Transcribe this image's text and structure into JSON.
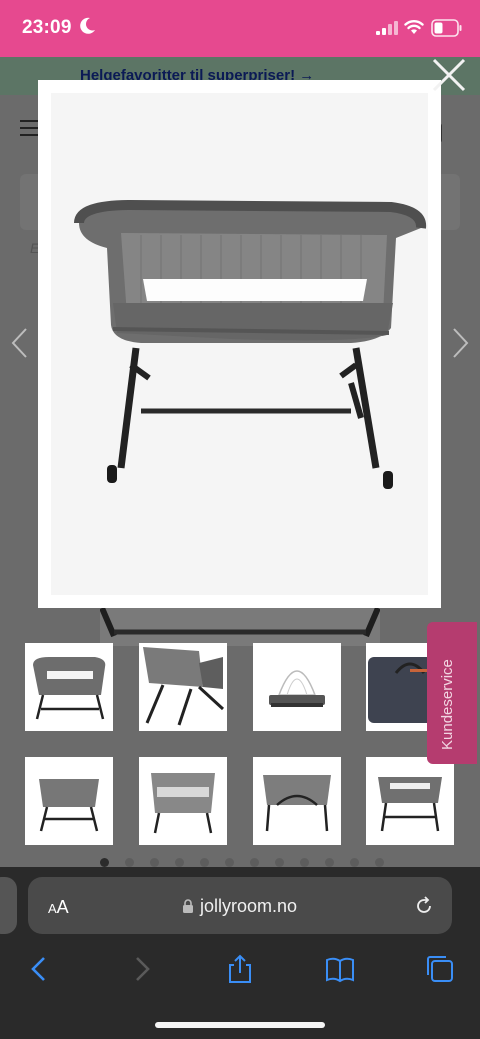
{
  "status_bar": {
    "time": "23:09",
    "icons": [
      "moon-icon",
      "signal-icon",
      "wifi-icon",
      "battery-icon"
    ]
  },
  "page": {
    "banner_text": "Helgefavoritter til superpriser! →",
    "ghost_text": "E",
    "kundeservice_label": "Kundeservice"
  },
  "gallery": {
    "thumbnails": [
      {
        "name": "thumb-1",
        "depicts": "bedside crib front view"
      },
      {
        "name": "thumb-2",
        "depicts": "bedside crib angled view"
      },
      {
        "name": "thumb-3",
        "depicts": "crib with mosquito net"
      },
      {
        "name": "thumb-4",
        "depicts": "carry bag"
      },
      {
        "name": "thumb-5",
        "depicts": "crib low position"
      },
      {
        "name": "thumb-6",
        "depicts": "crib travel cot mode"
      },
      {
        "name": "thumb-7",
        "depicts": "crib playpen mode"
      },
      {
        "name": "thumb-8",
        "depicts": "crib side view"
      }
    ],
    "page_dots": 12,
    "active_dot": 0
  },
  "browser": {
    "aa_label_small": "A",
    "aa_label_large": "A",
    "url": "jollyroom.no"
  },
  "colors": {
    "status_bar": "#e6498f",
    "kundeservice": "#b53c6f",
    "browser_accent": "#3a8ef6"
  }
}
